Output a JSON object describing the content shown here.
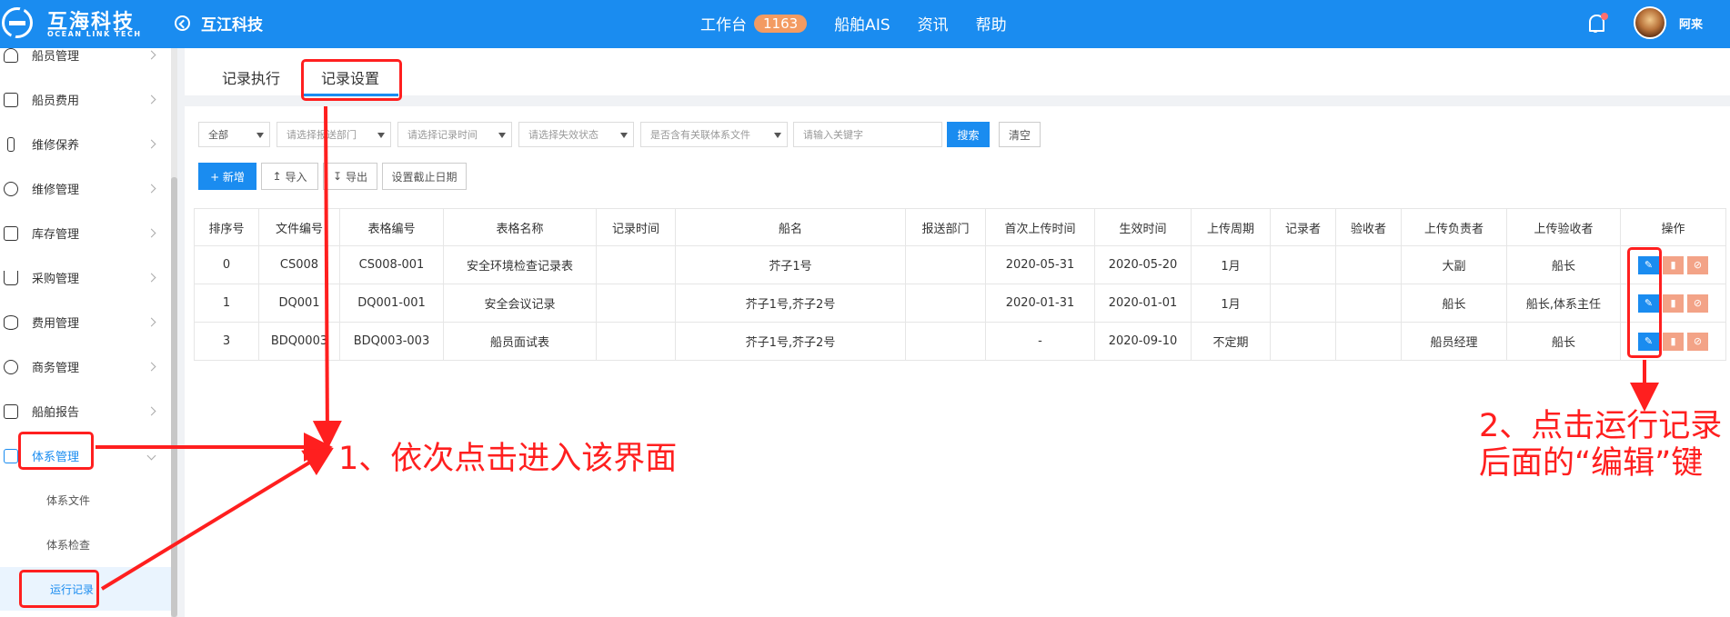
{
  "header": {
    "logo_cn": "互海科技",
    "logo_en": "OCEAN LINK TECH",
    "company": "互江科技",
    "nav": [
      {
        "label": "工作台",
        "badge": "1163"
      },
      {
        "label": "船舶AIS"
      },
      {
        "label": "资讯"
      },
      {
        "label": "帮助"
      }
    ],
    "username": "阿来"
  },
  "sidebar": {
    "items": [
      {
        "label": "船员管理",
        "icon": "user-icon"
      },
      {
        "label": "船员费用",
        "icon": "wallet-icon"
      },
      {
        "label": "维修保养",
        "icon": "wrench-icon"
      },
      {
        "label": "维修管理",
        "icon": "tool-icon"
      },
      {
        "label": "库存管理",
        "icon": "home-icon"
      },
      {
        "label": "采购管理",
        "icon": "cart-icon"
      },
      {
        "label": "费用管理",
        "icon": "coins-icon"
      },
      {
        "label": "商务管理",
        "icon": "globe-icon"
      },
      {
        "label": "船舶报告",
        "icon": "calendar-icon"
      },
      {
        "label": "体系管理",
        "icon": "document-icon"
      }
    ],
    "sub_items": [
      {
        "label": "体系文件"
      },
      {
        "label": "体系检查"
      },
      {
        "label": "运行记录"
      }
    ]
  },
  "tabs": [
    {
      "label": "记录执行"
    },
    {
      "label": "记录设置"
    }
  ],
  "filters": {
    "scope": "全部",
    "department": "请选择报送部门",
    "record_time": "请选择记录时间",
    "invalid_status": "请选择失效状态",
    "related_docs": "是否含有关联体系文件",
    "keyword_placeholder": "请输入关键字",
    "search_label": "搜索",
    "clear_label": "清空"
  },
  "toolbar": {
    "add_label": "+ 新增",
    "import_label": "导入",
    "export_label": "导出",
    "deadline_label": "设置截止日期"
  },
  "table": {
    "columns": [
      "排序号",
      "文件编号",
      "表格编号",
      "表格名称",
      "记录时间",
      "船名",
      "报送部门",
      "首次上传时间",
      "生效时间",
      "上传周期",
      "记录者",
      "验收者",
      "上传负责者",
      "上传验收者",
      "操作"
    ],
    "rows": [
      [
        "0",
        "CS008",
        "CS008-001",
        "安全环境检查记录表",
        "",
        "芥子1号",
        "",
        "2020-05-31",
        "2020-05-20",
        "1月",
        "",
        "",
        "大副",
        "船长"
      ],
      [
        "1",
        "DQ001",
        "DQ001-001",
        "安全会议记录",
        "",
        "芥子1号,芥子2号",
        "",
        "2020-01-31",
        "2020-01-01",
        "1月",
        "",
        "",
        "船长",
        "船长,体系主任"
      ],
      [
        "3",
        "BDQ0003",
        "BDQ003-003",
        "船员面试表",
        "",
        "芥子1号,芥子2号",
        "",
        "-",
        "2020-09-10",
        "不定期",
        "",
        "",
        "船员经理",
        "船长"
      ]
    ]
  },
  "annotations": {
    "step1": "1、依次点击进入该界面",
    "step2_line1": "2、点击运行记录",
    "step2_line2": "后面的“编辑”键",
    "color": "#ff1f1f"
  }
}
